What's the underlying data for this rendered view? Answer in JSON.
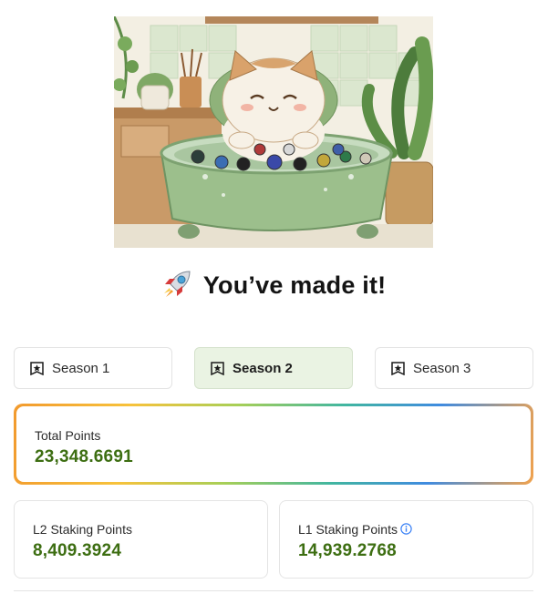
{
  "hero": {
    "image_alt": "Cat relaxing in a green bathtub with coins",
    "icon": "cat-bath-illustration"
  },
  "heading": {
    "icon": "rocket-icon",
    "text": "You’ve made it!"
  },
  "seasons": [
    {
      "label": "Season 1",
      "active": false,
      "icon": "star-badge-icon"
    },
    {
      "label": "Season 2",
      "active": true,
      "icon": "star-badge-icon"
    },
    {
      "label": "Season 3",
      "active": false,
      "icon": "star-badge-icon"
    }
  ],
  "total": {
    "label": "Total Points",
    "value": "23,348.6691"
  },
  "l2": {
    "label": "L2 Staking Points",
    "value": "8,409.3924"
  },
  "l1": {
    "label": "L1 Staking Points",
    "value": "14,939.2768",
    "info_icon": "info-icon"
  },
  "colors": {
    "accent_green": "#3d6e12",
    "active_tab_bg": "#eaf3e3"
  }
}
